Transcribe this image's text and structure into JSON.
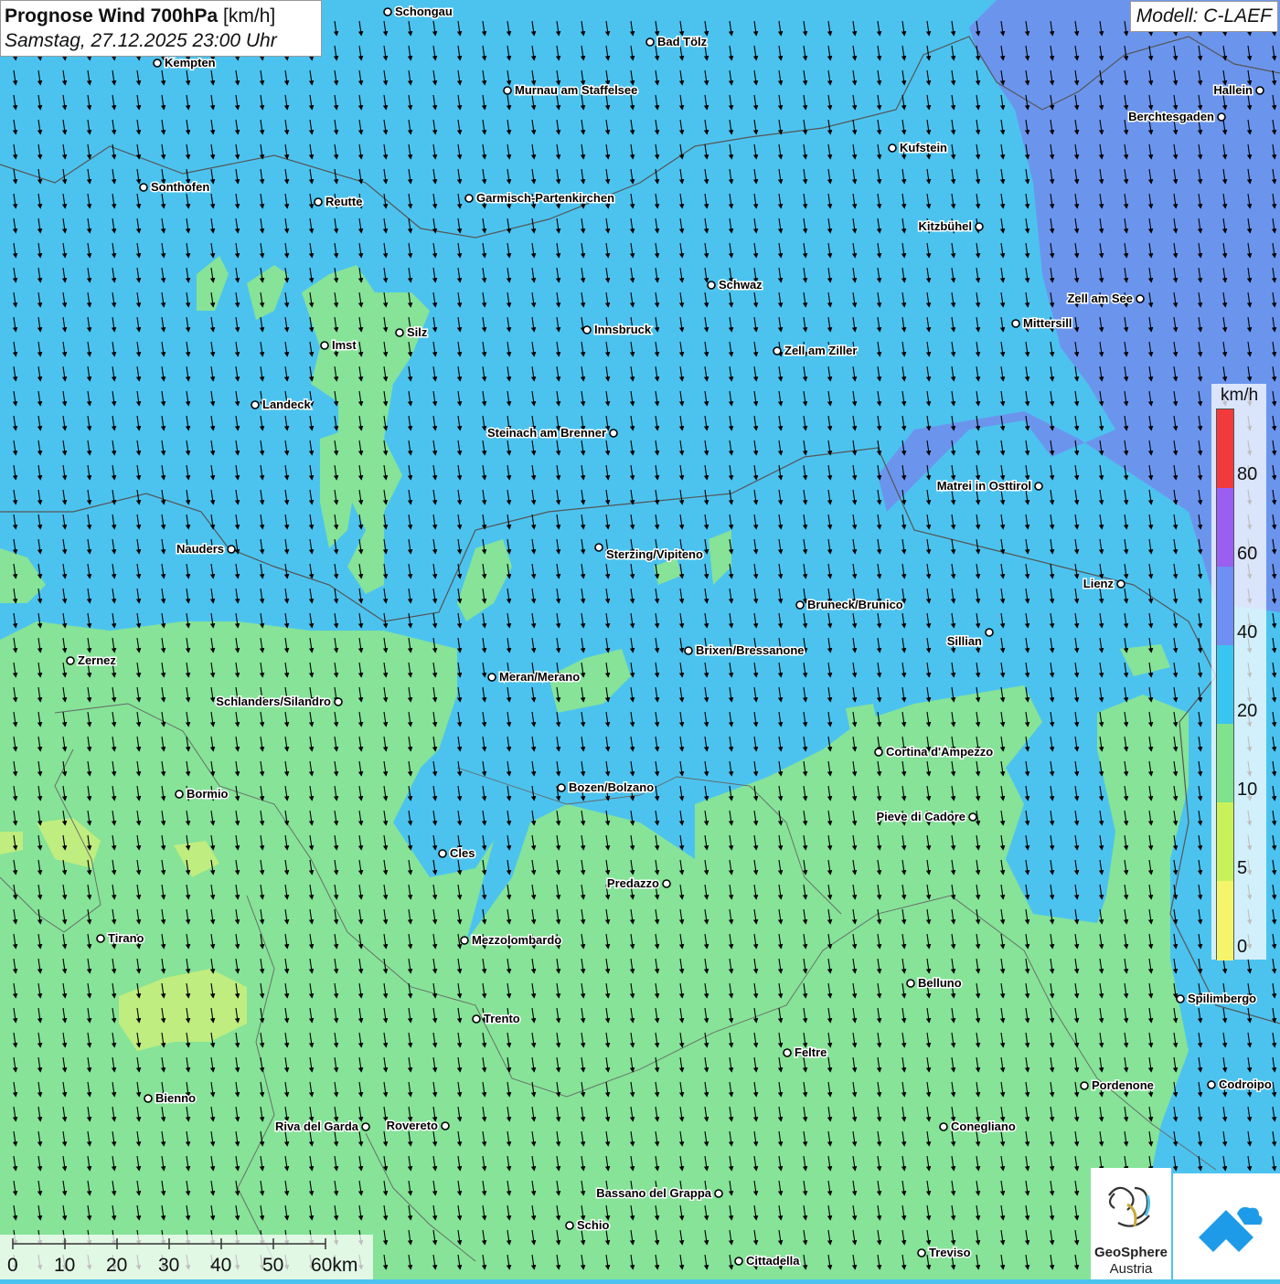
{
  "title": {
    "prefix": "Prognose Wind 700hPa",
    "unit": "[km/h]",
    "datetime": "Samstag, 27.12.2025 23:00 Uhr"
  },
  "model": "Modell: C-LAEF",
  "wind_direction": "from north (arrows pointing south)",
  "legend": {
    "unit": "km/h",
    "ticks": [
      "80",
      "60",
      "40",
      "20",
      "10",
      "5",
      "0"
    ],
    "colors": [
      "#f33a3a",
      "#9a5ef0",
      "#6e8ff3",
      "#38c6f1",
      "#7ee38c",
      "#c9f25a",
      "#f5f56b"
    ]
  },
  "scalebar": {
    "labels": [
      "0",
      "10",
      "20",
      "30",
      "40",
      "50",
      "60km"
    ]
  },
  "logo": {
    "line1": "GeoSphere",
    "line2": "Austria"
  },
  "cities": [
    {
      "name": "Schongau"
    },
    {
      "name": "Bad Tölz"
    },
    {
      "name": "Kempten"
    },
    {
      "name": "Murnau am Staffelsee"
    },
    {
      "name": "Hallein"
    },
    {
      "name": "Berchtesgaden"
    },
    {
      "name": "Kufstein"
    },
    {
      "name": "Sonthofen"
    },
    {
      "name": "Reutte"
    },
    {
      "name": "Garmisch-Partenkirchen"
    },
    {
      "name": "Kitzbühel"
    },
    {
      "name": "Schwaz"
    },
    {
      "name": "Zell am See"
    },
    {
      "name": "Mittersill"
    },
    {
      "name": "Innsbruck"
    },
    {
      "name": "Silz"
    },
    {
      "name": "Imst"
    },
    {
      "name": "Zell am Ziller"
    },
    {
      "name": "Landeck"
    },
    {
      "name": "Steinach am Brenner"
    },
    {
      "name": "Matrei in Osttirol"
    },
    {
      "name": "Nauders"
    },
    {
      "name": "Sterzing/Vipiteno"
    },
    {
      "name": "Lienz"
    },
    {
      "name": "Bruneck/Brunico"
    },
    {
      "name": "Sillian"
    },
    {
      "name": "Zernez"
    },
    {
      "name": "Brixen/Bressanone"
    },
    {
      "name": "Meran/Merano"
    },
    {
      "name": "Schlanders/Silandro"
    },
    {
      "name": "Cortina d'Ampezzo"
    },
    {
      "name": "Bozen/Bolzano"
    },
    {
      "name": "Bormio"
    },
    {
      "name": "Pieve di Cadore"
    },
    {
      "name": "Cles"
    },
    {
      "name": "Predazzo"
    },
    {
      "name": "Tirano"
    },
    {
      "name": "Mezzolombardo"
    },
    {
      "name": "Belluno"
    },
    {
      "name": "Spilimbergo"
    },
    {
      "name": "Trento"
    },
    {
      "name": "Feltre"
    },
    {
      "name": "Pordenone"
    },
    {
      "name": "Codroipo"
    },
    {
      "name": "Bienno"
    },
    {
      "name": "Riva del Garda"
    },
    {
      "name": "Rovereto"
    },
    {
      "name": "Conegliano"
    },
    {
      "name": "Bassano del Grappa"
    },
    {
      "name": "Schio"
    },
    {
      "name": "Treviso"
    },
    {
      "name": "Cittadella"
    }
  ]
}
